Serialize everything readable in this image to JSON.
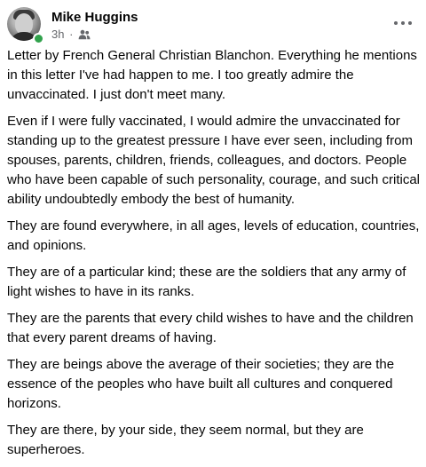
{
  "post": {
    "author": "Mike Huggins",
    "timestamp": "3h",
    "separator": "·",
    "audience_icon": "friends-icon",
    "more_icon": "more-options-icon",
    "paragraphs": [
      "Letter by French General Christian Blanchon. Everything he mentions in this letter I've had happen to me. I too greatly admire the unvaccinated. I just don't meet many.",
      "Even if I were fully vaccinated, I would admire the unvaccinated for standing up to the greatest pressure I have ever seen, including from spouses, parents, children, friends, colleagues, and doctors. People who have been capable of such personality, courage, and such critical ability undoubtedly embody the best of humanity.",
      "They are found everywhere, in all ages, levels of education, countries, and opinions.",
      "They are of a particular kind; these are the soldiers that any army of light wishes to have in its ranks.",
      "They are the parents that every child wishes to have and the children that every parent dreams of having.",
      "They are beings above the average of their societies; they are the essence of the peoples who have built all cultures and conquered horizons.",
      "They are there, by your side, they seem normal, but they are superheroes."
    ]
  }
}
